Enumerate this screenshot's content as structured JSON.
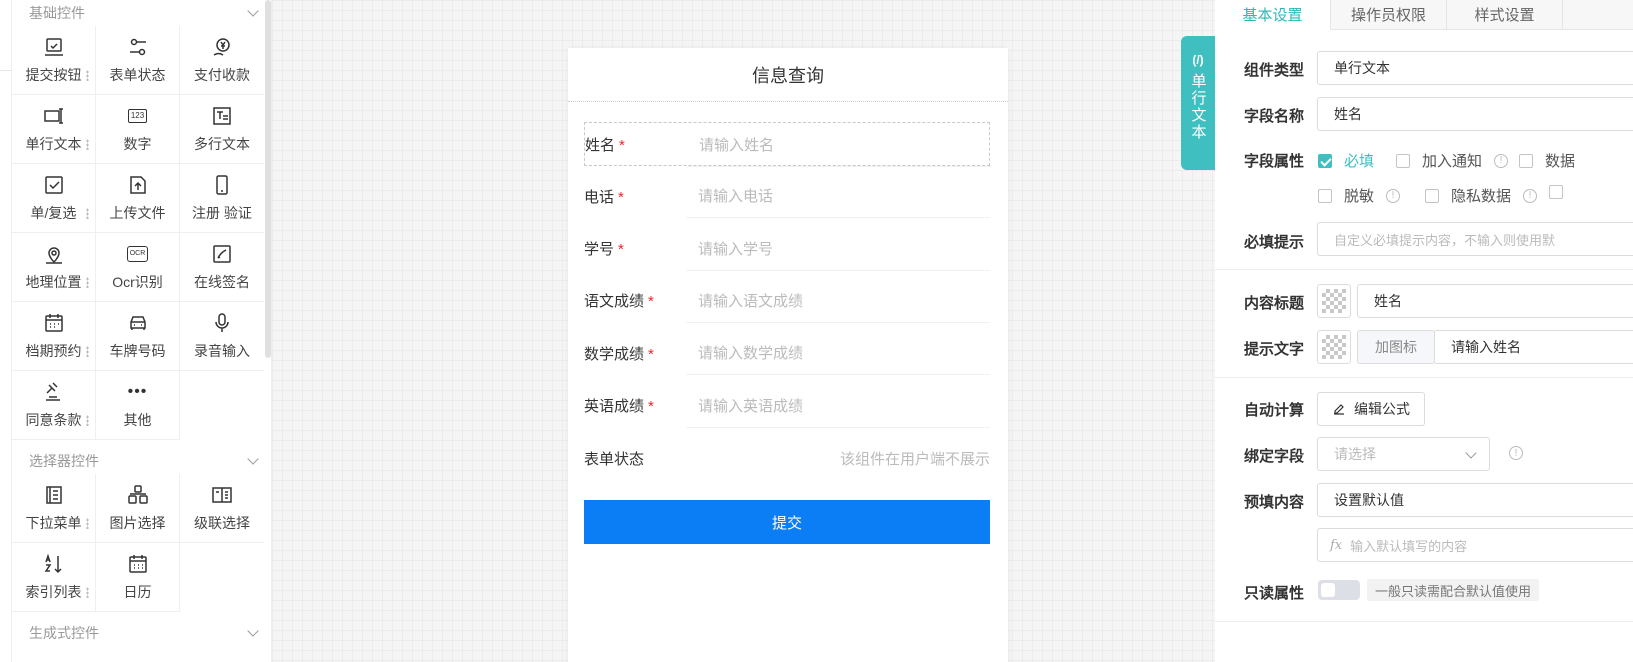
{
  "palette": {
    "basic": {
      "title": "基础控件",
      "items": [
        {
          "label": "提交按钮",
          "icon": "submit-button-icon"
        },
        {
          "label": "表单状态",
          "icon": "form-status-icon"
        },
        {
          "label": "支付收款",
          "icon": "payment-icon"
        },
        {
          "label": "单行文本",
          "icon": "single-line-text-icon"
        },
        {
          "label": "数字",
          "icon": "number-icon",
          "icon_text": "123"
        },
        {
          "label": "多行文本",
          "icon": "multi-line-text-icon"
        },
        {
          "label": "单/复选",
          "icon": "checkbox-icon"
        },
        {
          "label": "上传文件",
          "icon": "upload-file-icon"
        },
        {
          "label": "注册 验证",
          "icon": "phone-verify-icon"
        },
        {
          "label": "地理位置",
          "icon": "location-icon"
        },
        {
          "label": "Ocr识别",
          "icon": "ocr-icon",
          "icon_text": "OCR"
        },
        {
          "label": "在线签名",
          "icon": "signature-icon"
        },
        {
          "label": "档期预约",
          "icon": "calendar-booking-icon"
        },
        {
          "label": "车牌号码",
          "icon": "car-plate-icon"
        },
        {
          "label": "录音输入",
          "icon": "microphone-icon"
        },
        {
          "label": "同意条款",
          "icon": "agreement-icon"
        },
        {
          "label": "其他",
          "icon": "more-icon",
          "icon_text": "•••"
        }
      ]
    },
    "selector": {
      "title": "选择器控件",
      "items": [
        {
          "label": "下拉菜单",
          "icon": "dropdown-icon"
        },
        {
          "label": "图片选择",
          "icon": "image-select-icon"
        },
        {
          "label": "级联选择",
          "icon": "cascade-select-icon"
        },
        {
          "label": "索引列表",
          "icon": "sort-az-icon"
        },
        {
          "label": "日历",
          "icon": "calendar-icon"
        }
      ]
    },
    "generated": {
      "title": "生成式控件"
    }
  },
  "form": {
    "title": "信息查询",
    "fields": [
      {
        "label": "姓名",
        "required": "*",
        "placeholder": "请输入姓名"
      },
      {
        "label": "电话",
        "required": "*",
        "placeholder": "请输入电话"
      },
      {
        "label": "学号",
        "required": "*",
        "placeholder": "请输入学号"
      },
      {
        "label": "语文成绩",
        "required": "*",
        "placeholder": "请输入语文成绩"
      },
      {
        "label": "数学成绩",
        "required": "*",
        "placeholder": "请输入数学成绩"
      },
      {
        "label": "英语成绩",
        "required": "*",
        "placeholder": "请输入英语成绩"
      }
    ],
    "status": {
      "label": "表单状态",
      "hint": "该组件在用户端不展示"
    },
    "submit_label": "提交"
  },
  "side_tab": {
    "icon_text": "(/)",
    "label": "单行文本"
  },
  "settings": {
    "tabs": [
      "基本设置",
      "操作员权限",
      "样式设置"
    ],
    "active_tab": 0,
    "component_type": {
      "label": "组件类型",
      "value": "单行文本"
    },
    "field_name": {
      "label": "字段名称",
      "value": "姓名"
    },
    "field_props": {
      "label": "字段属性",
      "options": [
        {
          "label": "必填",
          "checked": true
        },
        {
          "label": "加入通知",
          "checked": false,
          "info": true
        },
        {
          "label": "数据",
          "checked": false
        },
        {
          "label": "脱敏",
          "checked": false,
          "info": true
        },
        {
          "label": "隐私数据",
          "checked": false,
          "info": true
        }
      ]
    },
    "required_hint": {
      "label": "必填提示",
      "placeholder": "自定义必填提示内容，不输入则使用默"
    },
    "content_title": {
      "label": "内容标题",
      "value": "姓名"
    },
    "hint_text": {
      "label": "提示文字",
      "add_icon_label": "加图标",
      "value": "请输入姓名"
    },
    "auto_calc": {
      "label": "自动计算",
      "button_label": "编辑公式"
    },
    "bind_field": {
      "label": "绑定字段",
      "placeholder": "请选择"
    },
    "prefill": {
      "label": "预填内容",
      "value": "设置默认值",
      "formula_prefix": "fx",
      "formula_placeholder": "输入默认填写的内容"
    },
    "readonly": {
      "label": "只读属性",
      "note": "一般只读需配合默认值使用",
      "enabled": false
    }
  },
  "colors": {
    "accent": "#40bfc1",
    "submit": "#0b7ef5",
    "required": "#f5222d"
  }
}
